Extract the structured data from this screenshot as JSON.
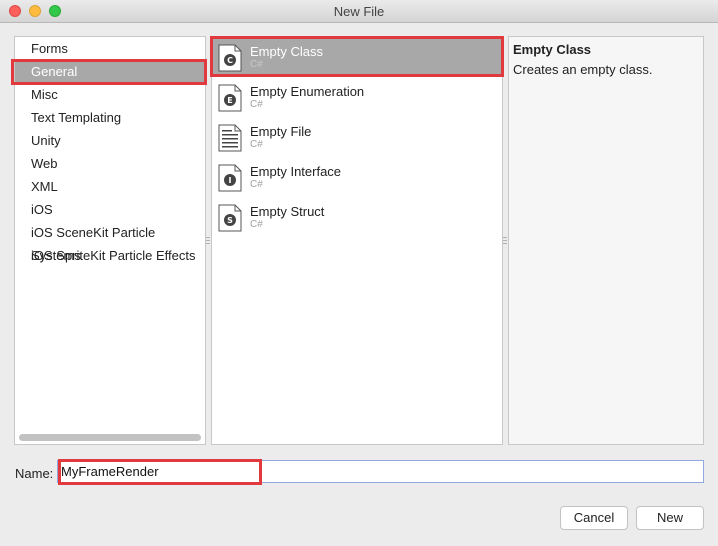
{
  "window": {
    "title": "New File"
  },
  "categories": [
    {
      "label": "Forms",
      "selected": false
    },
    {
      "label": "General",
      "selected": true
    },
    {
      "label": "Misc",
      "selected": false
    },
    {
      "label": "Text Templating",
      "selected": false
    },
    {
      "label": "Unity",
      "selected": false
    },
    {
      "label": "Web",
      "selected": false
    },
    {
      "label": "XML",
      "selected": false
    },
    {
      "label": "iOS",
      "selected": false
    },
    {
      "label": "iOS SceneKit Particle Systems",
      "selected": false
    },
    {
      "label": "iOS SpriteKit Particle Effects",
      "selected": false
    }
  ],
  "templates": [
    {
      "name": "Empty Class",
      "language": "C#",
      "icon": "class-file-icon",
      "selected": true
    },
    {
      "name": "Empty Enumeration",
      "language": "C#",
      "icon": "enumeration-file-icon",
      "selected": false
    },
    {
      "name": "Empty File",
      "language": "C#",
      "icon": "empty-file-icon",
      "selected": false
    },
    {
      "name": "Empty Interface",
      "language": "C#",
      "icon": "interface-file-icon",
      "selected": false
    },
    {
      "name": "Empty Struct",
      "language": "C#",
      "icon": "struct-file-icon",
      "selected": false
    }
  ],
  "description": {
    "title": "Empty Class",
    "text": "Creates an empty class."
  },
  "name_field": {
    "label": "Name:",
    "value": "MyFrameRender"
  },
  "buttons": {
    "cancel": "Cancel",
    "new": "New"
  },
  "colors": {
    "selection": "#a8a8a8",
    "highlight_annotation": "#e0393e",
    "close": "#fc605b",
    "minimize": "#fdbc40",
    "maximize": "#34c84a"
  }
}
